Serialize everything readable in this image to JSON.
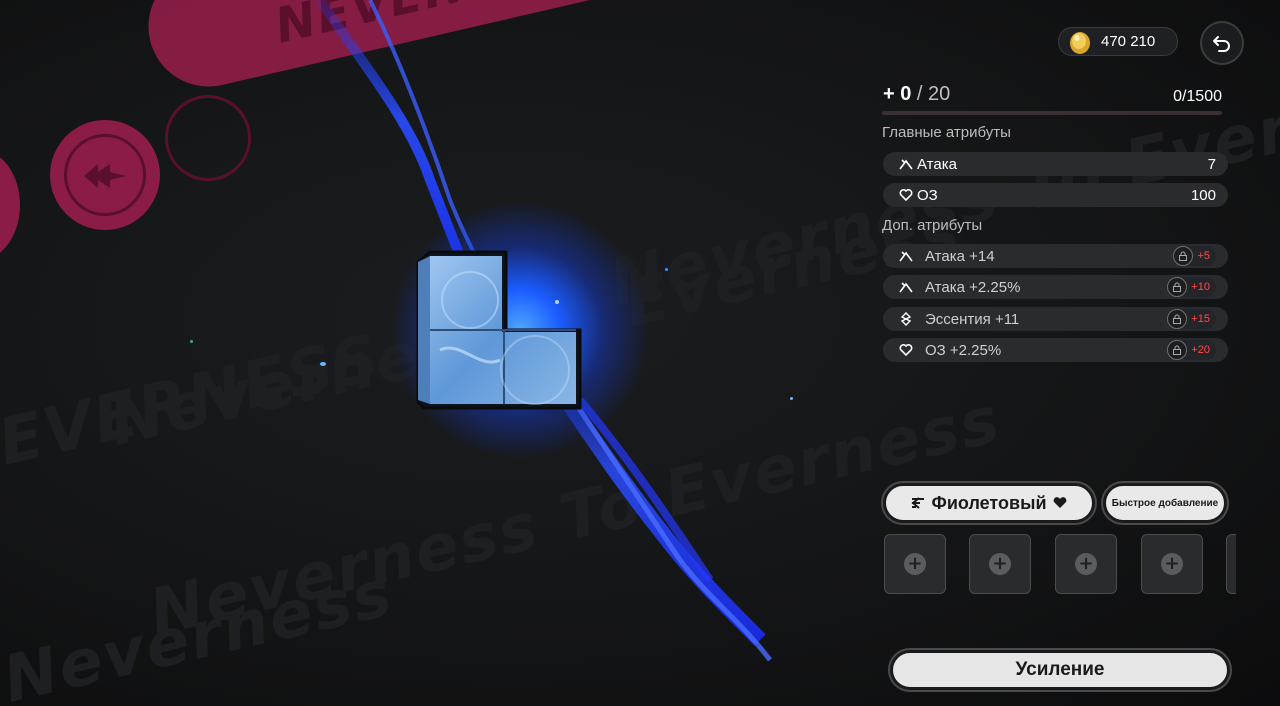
{
  "background": {
    "band_text": "NEVERNESS TO EVERNESS",
    "words": [
      "Neverness To Everness",
      "Neverness To Everness",
      "NEVERNESS",
      "Neverness To Everness",
      "Neverness"
    ]
  },
  "currency": {
    "value": "470 210",
    "icon": "gold-coin-icon"
  },
  "header": {
    "back_icon": "undo-icon"
  },
  "level": {
    "current": "+ 0",
    "separator": " / ",
    "max": "20",
    "exp": "0/1500",
    "exp_fraction": 0
  },
  "main_attributes": {
    "title": "Главные атрибуты",
    "items": [
      {
        "icon": "attack-icon",
        "label": "Атака",
        "value": "7"
      },
      {
        "icon": "hp-heart-icon",
        "label": "ОЗ",
        "value": "100"
      }
    ]
  },
  "sub_attributes": {
    "title": "Доп. атрибуты",
    "items": [
      {
        "icon": "attack-icon",
        "label": "Атака +14",
        "unlock": "+5"
      },
      {
        "icon": "attack-icon",
        "label": "Атака +2.25%",
        "unlock": "+10"
      },
      {
        "icon": "essence-icon",
        "label": "Эссентия +11",
        "unlock": "+15"
      },
      {
        "icon": "hp-heart-icon",
        "label": "ОЗ +2.25%",
        "unlock": "+20"
      }
    ]
  },
  "material": {
    "filter_label": "Фиолетовый",
    "quick_add": "Быстрое добавление",
    "slots": [
      "+",
      "+",
      "+",
      "+"
    ]
  },
  "enhance_button": "Усиление",
  "colors": {
    "accent_band": "#8a1c47",
    "glow": "#1a5cff",
    "lock_red": "#ff4b4b"
  }
}
